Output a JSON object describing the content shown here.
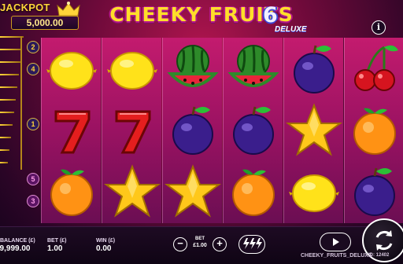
{
  "jackpot": {
    "label": "JACKPOT",
    "value": "5,000.00"
  },
  "title": {
    "main": "CHEEKY FRUITS",
    "number": "6",
    "suffix": "DELUXE"
  },
  "info_label": "i",
  "paylines": {
    "left_top": "2",
    "left_second": "4",
    "left_middle": "1",
    "left_fourth": "5",
    "left_fifth": "3"
  },
  "reels": [
    [
      "lemon",
      "seven",
      "orange"
    ],
    [
      "lemon",
      "seven",
      "star"
    ],
    [
      "watermelon",
      "plum",
      "star"
    ],
    [
      "watermelon",
      "plum",
      "orange"
    ],
    [
      "plum",
      "star",
      "lemon"
    ],
    [
      "cherries",
      "orange",
      "plum"
    ]
  ],
  "bottom_bar": {
    "balance_label": "BALANCE (£)",
    "balance_value": "£9,999.00",
    "bet_label": "BET (£)",
    "bet_value": "1.00",
    "win_label": "WIN (£)",
    "win_value": "0.00",
    "bet_center_label": "BET",
    "bet_center_value": "£1.00",
    "minus": "−",
    "plus": "+",
    "game_name": "CHEEKY_FRUITS_DELUXE",
    "id_text": "ID: 12402"
  },
  "icons": {
    "turbo": "lightning-icon",
    "play": "play-icon",
    "spin": "spin-icon",
    "info": "info-icon",
    "crown": "crown-icon"
  },
  "colors": {
    "accent": "#ffd43a",
    "reel": "#b0145e",
    "background": "#12031a"
  }
}
